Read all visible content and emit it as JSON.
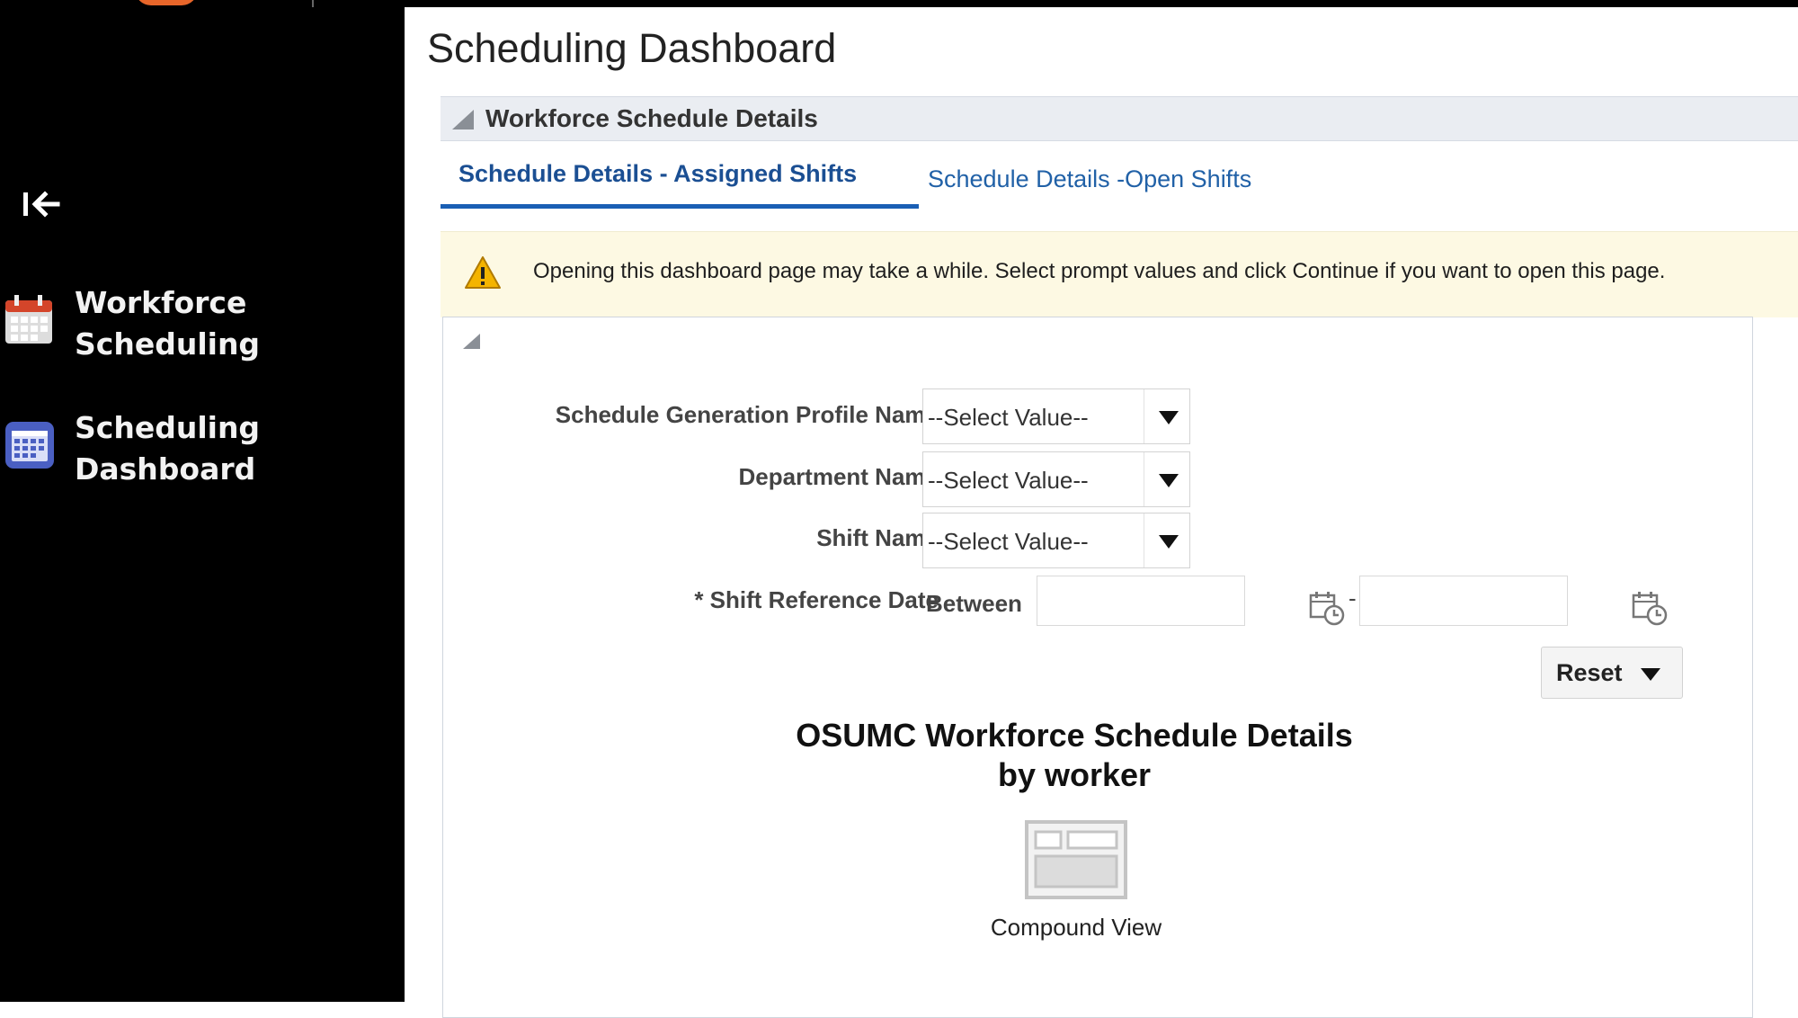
{
  "sidebar": {
    "items": [
      {
        "label_line1": "Workforce",
        "label_line2": "Scheduling",
        "icon": "calendar-icon"
      },
      {
        "label_line1": "Scheduling",
        "label_line2": "Dashboard",
        "icon": "calendar-grid-icon"
      }
    ],
    "collapse_icon": "collapse-left-icon"
  },
  "page": {
    "title": "Scheduling Dashboard"
  },
  "section": {
    "title": "Workforce Schedule Details"
  },
  "tabs": [
    {
      "label": "Schedule Details - Assigned Shifts",
      "active": true
    },
    {
      "label": "Schedule Details -Open Shifts",
      "active": false
    }
  ],
  "warning": {
    "message": "Opening this dashboard page may take a while. Select prompt values and click Continue if you want to open this page."
  },
  "prompts": {
    "fields": [
      {
        "label": "Schedule Generation Profile Name",
        "value": "--Select Value--"
      },
      {
        "label": "Department Name",
        "value": "--Select Value--"
      },
      {
        "label": "Shift Name",
        "value": "--Select Value--"
      }
    ],
    "date_field": {
      "label": "* Shift Reference Date",
      "operator": "Between",
      "separator": "-",
      "start_value": "",
      "end_value": ""
    },
    "reset_label": "Reset"
  },
  "report": {
    "title_line1": "OSUMC Workforce Schedule Details",
    "title_line2": "by worker",
    "view_label": "Compound View"
  },
  "colors": {
    "sidebar_bg": "#000000",
    "tab_active": "#1b4f93",
    "tab_underline": "#1a5fb4",
    "warning_bg": "#fdf9e3"
  }
}
